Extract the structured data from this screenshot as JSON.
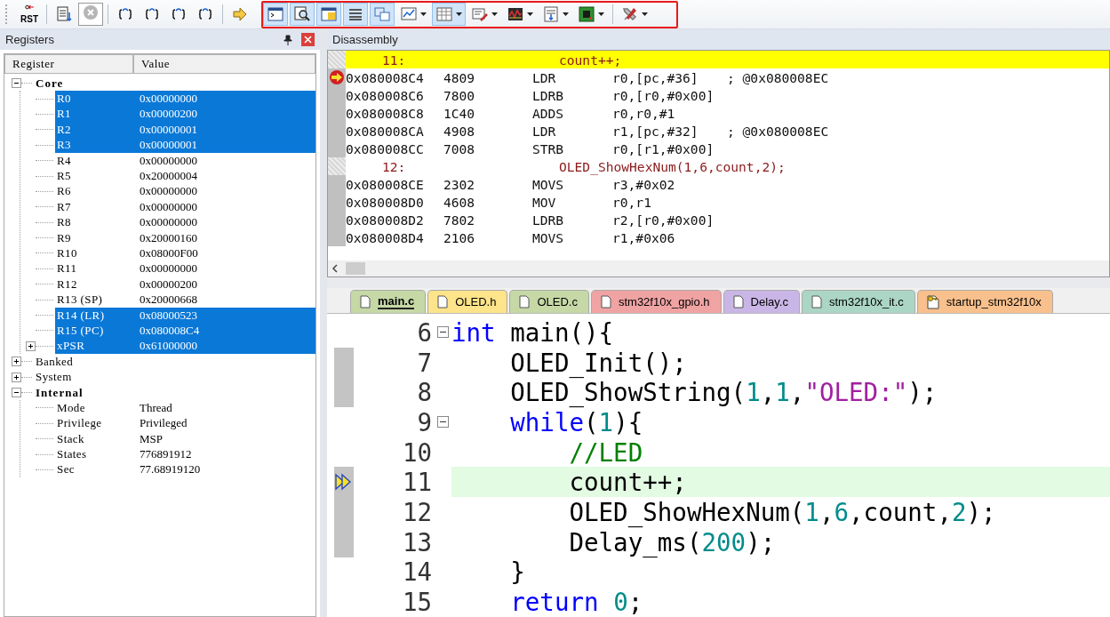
{
  "toolbar": {
    "groups": [
      {
        "outlined": false,
        "buttons": [
          {
            "label": "RST",
            "selected": false,
            "disabled": false,
            "dropdown": false
          },
          {
            "selected": false,
            "disabled": false,
            "dropdown": false
          },
          {
            "selected": false,
            "disabled": true,
            "dropdown": false
          },
          {
            "selected": false,
            "disabled": false,
            "dropdown": false
          },
          {
            "selected": false,
            "disabled": false,
            "dropdown": false
          },
          {
            "selected": false,
            "disabled": false,
            "dropdown": false
          },
          {
            "selected": false,
            "disabled": false,
            "dropdown": false
          },
          {
            "selected": false,
            "disabled": false,
            "dropdown": false
          }
        ]
      },
      {
        "outlined": true,
        "buttons": [
          {
            "selected": true,
            "disabled": false,
            "dropdown": false
          },
          {
            "selected": true,
            "disabled": false,
            "dropdown": false
          },
          {
            "selected": true,
            "disabled": false,
            "dropdown": false
          },
          {
            "selected": true,
            "disabled": false,
            "dropdown": false
          },
          {
            "selected": true,
            "disabled": false,
            "dropdown": false
          },
          {
            "selected": false,
            "disabled": false,
            "dropdown": true
          },
          {
            "selected": true,
            "disabled": false,
            "dropdown": true
          },
          {
            "selected": false,
            "disabled": false,
            "dropdown": true
          },
          {
            "selected": false,
            "disabled": false,
            "dropdown": true
          },
          {
            "selected": false,
            "disabled": false,
            "dropdown": true
          },
          {
            "selected": false,
            "disabled": false,
            "dropdown": true
          },
          {
            "selected": false,
            "disabled": false,
            "dropdown": true
          }
        ]
      }
    ]
  },
  "registers": {
    "title": "Registers",
    "columns": [
      "Register",
      "Value"
    ],
    "tree": [
      {
        "name": "Core",
        "expanded": true,
        "selected": false,
        "children": [
          {
            "name": "R0",
            "value": "0x00000000",
            "selected": true
          },
          {
            "name": "R1",
            "value": "0x00000200",
            "selected": true
          },
          {
            "name": "R2",
            "value": "0x00000001",
            "selected": true
          },
          {
            "name": "R3",
            "value": "0x00000001",
            "selected": true
          },
          {
            "name": "R4",
            "value": "0x00000000",
            "selected": false
          },
          {
            "name": "R5",
            "value": "0x20000004",
            "selected": false
          },
          {
            "name": "R6",
            "value": "0x00000000",
            "selected": false
          },
          {
            "name": "R7",
            "value": "0x00000000",
            "selected": false
          },
          {
            "name": "R8",
            "value": "0x00000000",
            "selected": false
          },
          {
            "name": "R9",
            "value": "0x20000160",
            "selected": false
          },
          {
            "name": "R10",
            "value": "0x08000F00",
            "selected": false
          },
          {
            "name": "R11",
            "value": "0x00000000",
            "selected": false
          },
          {
            "name": "R12",
            "value": "0x00000200",
            "selected": false
          },
          {
            "name": "R13 (SP)",
            "value": "0x20000668",
            "selected": false
          },
          {
            "name": "R14 (LR)",
            "value": "0x08000523",
            "selected": true
          },
          {
            "name": "R15 (PC)",
            "value": "0x080008C4",
            "selected": true
          },
          {
            "name": "xPSR",
            "value": "0x61000000",
            "selected": true,
            "expanded": false
          }
        ]
      },
      {
        "name": "Banked",
        "expanded": false,
        "selected": false
      },
      {
        "name": "System",
        "expanded": false,
        "selected": false
      },
      {
        "name": "Internal",
        "expanded": true,
        "selected": false,
        "children": [
          {
            "name": "Mode",
            "value": "Thread",
            "selected": false
          },
          {
            "name": "Privilege",
            "value": "Privileged",
            "selected": false
          },
          {
            "name": "Stack",
            "value": "MSP",
            "selected": false
          },
          {
            "name": "States",
            "value": "776891912",
            "selected": false
          },
          {
            "name": "Sec",
            "value": "77.68919120",
            "selected": false
          }
        ]
      }
    ]
  },
  "disassembly": {
    "title": "Disassembly",
    "rows": [
      {
        "kind": "source",
        "line": "11:",
        "code": "count++;",
        "current": true
      },
      {
        "kind": "instruction",
        "address": "0x080008C4",
        "opcode": "4809",
        "mnemonic": "LDR",
        "operands": "r0,[pc,#36]",
        "comment": "; @0x080008EC",
        "current": true
      },
      {
        "kind": "instruction",
        "address": "0x080008C6",
        "opcode": "7800",
        "mnemonic": "LDRB",
        "operands": "r0,[r0,#0x00]",
        "current": false
      },
      {
        "kind": "instruction",
        "address": "0x080008C8",
        "opcode": "1C40",
        "mnemonic": "ADDS",
        "operands": "r0,r0,#1",
        "current": false
      },
      {
        "kind": "instruction",
        "address": "0x080008CA",
        "opcode": "4908",
        "mnemonic": "LDR",
        "operands": "r1,[pc,#32]",
        "comment": "; @0x080008EC",
        "current": false
      },
      {
        "kind": "instruction",
        "address": "0x080008CC",
        "opcode": "7008",
        "mnemonic": "STRB",
        "operands": "r0,[r1,#0x00]",
        "current": false
      },
      {
        "kind": "source",
        "line": "12:",
        "code": "OLED_ShowHexNum(1,6,count,2);",
        "current": false
      },
      {
        "kind": "instruction",
        "address": "0x080008CE",
        "opcode": "2302",
        "mnemonic": "MOVS",
        "operands": "r3,#0x02",
        "current": false
      },
      {
        "kind": "instruction",
        "address": "0x080008D0",
        "opcode": "4608",
        "mnemonic": "MOV",
        "operands": "r0,r1",
        "current": false
      },
      {
        "kind": "instruction",
        "address": "0x080008D2",
        "opcode": "7802",
        "mnemonic": "LDRB",
        "operands": "r2,[r0,#0x00]",
        "current": false
      },
      {
        "kind": "instruction",
        "address": "0x080008D4",
        "opcode": "2106",
        "mnemonic": "MOVS",
        "operands": "r1,#0x06",
        "current": false
      }
    ]
  },
  "editor": {
    "tabs": [
      {
        "label": "main.c",
        "kind": "source",
        "selected": true,
        "color": "#c5d8a6"
      },
      {
        "label": "OLED.h",
        "kind": "source",
        "selected": false,
        "color": "#fde38a"
      },
      {
        "label": "OLED.c",
        "kind": "source",
        "selected": false,
        "color": "#c5d8a6"
      },
      {
        "label": "stm32f10x_gpio.h",
        "kind": "source",
        "selected": false,
        "color": "#f0a3a3"
      },
      {
        "label": "Delay.c",
        "kind": "source",
        "selected": false,
        "color": "#c9b6e6"
      },
      {
        "label": "stm32f10x_it.c",
        "kind": "source",
        "selected": false,
        "color": "#abd5c5"
      },
      {
        "label": "startup_stm32f10x",
        "kind": "startup",
        "selected": false,
        "color": "#f8c08c"
      }
    ],
    "lines": [
      {
        "number": "6",
        "fold": true,
        "current": false,
        "executed": false,
        "tokens": [
          {
            "kind": "keyword",
            "text": "int"
          },
          {
            "kind": "plain",
            "text": " main(){"
          }
        ]
      },
      {
        "number": "7",
        "fold": false,
        "current": false,
        "executed": true,
        "tokens": [
          {
            "kind": "plain",
            "text": "    OLED_Init();"
          }
        ]
      },
      {
        "number": "8",
        "fold": false,
        "current": false,
        "executed": true,
        "tokens": [
          {
            "kind": "plain",
            "text": "    OLED_ShowString("
          },
          {
            "kind": "number",
            "text": "1"
          },
          {
            "kind": "plain",
            "text": ","
          },
          {
            "kind": "number",
            "text": "1"
          },
          {
            "kind": "plain",
            "text": ","
          },
          {
            "kind": "string",
            "text": "\"OLED:\""
          },
          {
            "kind": "plain",
            "text": ");"
          }
        ]
      },
      {
        "number": "9",
        "fold": true,
        "current": false,
        "executed": false,
        "tokens": [
          {
            "kind": "keyword",
            "text": "    while"
          },
          {
            "kind": "plain",
            "text": "("
          },
          {
            "kind": "number",
            "text": "1"
          },
          {
            "kind": "plain",
            "text": "){"
          }
        ]
      },
      {
        "number": "10",
        "fold": false,
        "current": false,
        "executed": false,
        "tokens": [
          {
            "kind": "comment",
            "text": "        //LED"
          }
        ]
      },
      {
        "number": "11",
        "fold": false,
        "current": true,
        "executed": true,
        "tokens": [
          {
            "kind": "plain",
            "text": "        count++;"
          }
        ]
      },
      {
        "number": "12",
        "fold": false,
        "current": false,
        "executed": true,
        "tokens": [
          {
            "kind": "plain",
            "text": "        OLED_ShowHexNum("
          },
          {
            "kind": "number",
            "text": "1"
          },
          {
            "kind": "plain",
            "text": ","
          },
          {
            "kind": "number",
            "text": "6"
          },
          {
            "kind": "plain",
            "text": ",count,"
          },
          {
            "kind": "number",
            "text": "2"
          },
          {
            "kind": "plain",
            "text": ");"
          }
        ]
      },
      {
        "number": "13",
        "fold": false,
        "current": false,
        "executed": true,
        "tokens": [
          {
            "kind": "plain",
            "text": "        Delay_ms("
          },
          {
            "kind": "number",
            "text": "200"
          },
          {
            "kind": "plain",
            "text": ");"
          }
        ]
      },
      {
        "number": "14",
        "fold": false,
        "current": false,
        "executed": false,
        "tokens": [
          {
            "kind": "plain",
            "text": "    }"
          }
        ]
      },
      {
        "number": "15",
        "fold": false,
        "current": false,
        "executed": false,
        "tokens": [
          {
            "kind": "keyword",
            "text": "    return "
          },
          {
            "kind": "number",
            "text": "0"
          },
          {
            "kind": "plain",
            "text": ";"
          }
        ]
      }
    ]
  }
}
